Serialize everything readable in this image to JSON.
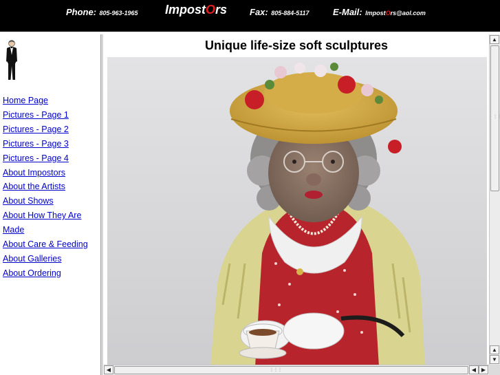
{
  "header": {
    "phone_label": "Phone:",
    "phone_number": "805-963-1965",
    "brand_pre": "Impost",
    "brand_o": "O",
    "brand_post": "rs",
    "fax_label": "Fax:",
    "fax_number": "805-884-5117",
    "email_label": "E-Mail:",
    "email_pre": "Impost",
    "email_o": "O",
    "email_post": "rs@aol.com"
  },
  "nav": {
    "items": [
      {
        "label": "Home Page"
      },
      {
        "label": "Pictures - Page 1"
      },
      {
        "label": "Pictures - Page 2"
      },
      {
        "label": "Pictures - Page 3"
      },
      {
        "label": "Pictures - Page 4"
      },
      {
        "label": "About Impostors"
      },
      {
        "label": "About the Artists"
      },
      {
        "label": "About Shows"
      },
      {
        "label": "About How They Are Made"
      },
      {
        "label": "About Care & Feeding"
      },
      {
        "label": "About Galleries"
      },
      {
        "label": "About Ordering"
      }
    ]
  },
  "main": {
    "title": "Unique life-size soft sculptures"
  },
  "scrollbars": {
    "vertical_position": 0.0,
    "horizontal_position": 0.5
  },
  "colors": {
    "topbar_bg": "#000000",
    "topbar_text": "#ffffff",
    "brand_accent": "#e02020",
    "link": "#0000cc"
  }
}
